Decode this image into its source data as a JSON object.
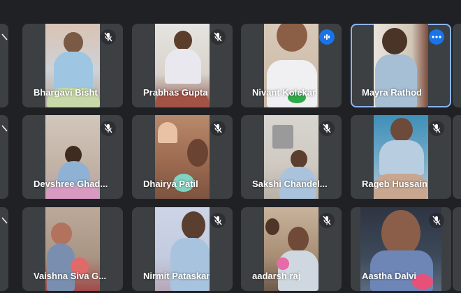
{
  "meeting": {
    "participants": [
      {
        "name": "Bhargavi Bisht",
        "indicator": "mic-off-icon"
      },
      {
        "name": "Prabhas Gupta",
        "indicator": "mic-off-icon"
      },
      {
        "name": "Nivant Kolekar",
        "indicator": "speaking-icon"
      },
      {
        "name": "Mayra Rathod",
        "indicator": "more-options-icon",
        "active": true
      },
      {
        "name": "Devshree Ghad...",
        "indicator": "mic-off-icon"
      },
      {
        "name": "Dhairya Patil",
        "indicator": "mic-off-icon"
      },
      {
        "name": "Sakshi Chandel...",
        "indicator": "mic-off-icon"
      },
      {
        "name": "Rageb Hussain",
        "indicator": "mic-off-icon"
      },
      {
        "name": "Vaishna Siva G...",
        "indicator": "mic-off-icon"
      },
      {
        "name": "Nirmit Pataskar",
        "indicator": "mic-off-icon"
      },
      {
        "name": "aadarsh raj",
        "indicator": "mic-off-icon"
      },
      {
        "name": "Aastha Dalvi",
        "indicator": "mic-off-icon"
      }
    ]
  },
  "colors": {
    "background": "#202124",
    "tile": "#3c4043",
    "active_border": "#8ab4f8",
    "accent": "#1a73e8"
  }
}
